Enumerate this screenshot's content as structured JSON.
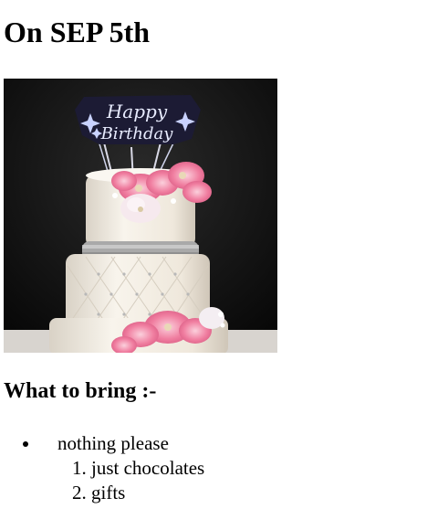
{
  "heading": "On SEP 5th",
  "image": {
    "topper_line1": "Happy",
    "topper_line2": "Birthday",
    "colors": {
      "background": "#0c0c0c",
      "cake": "#f4efe6",
      "flower": "#f07ea0",
      "topper": "#1c1b34",
      "beads": "#a9a9a9"
    }
  },
  "section_heading": "What to bring :-",
  "list": {
    "items": [
      {
        "label": "nothing please",
        "subitems": [
          "just chocolates",
          "gifts"
        ]
      }
    ]
  }
}
